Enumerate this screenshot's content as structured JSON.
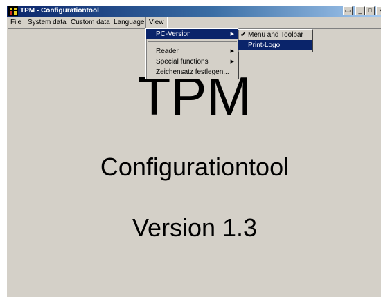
{
  "window": {
    "title": "TPM - Configurationtool",
    "buttons": {
      "restore": "▭",
      "minimize": "_",
      "maximize": "□",
      "close": "×"
    }
  },
  "menubar": {
    "items": [
      "File",
      "System data",
      "Custom data",
      "Language",
      "View"
    ]
  },
  "view_menu": {
    "items": [
      {
        "label": "PC-Version",
        "submenu": true,
        "highlighted": true
      },
      {
        "label": "Reader",
        "submenu": true
      },
      {
        "label": "Special functions",
        "submenu": true
      },
      {
        "label": "Zeichensatz festlegen..."
      }
    ]
  },
  "pc_version_submenu": {
    "items": [
      {
        "label": "Menu and Toolbar",
        "checked": true,
        "check_mark": "✔"
      },
      {
        "label": "Print-Logo",
        "highlighted": true
      }
    ]
  },
  "main": {
    "heading": "TPM",
    "subheading": "Configurationtool",
    "version": "Version 1.3"
  },
  "colors": {
    "face": "#d4d0c8",
    "title_active": "#0a246a",
    "highlight": "#0a246a",
    "highlight_text": "#ffffff"
  },
  "icons": {
    "app": "tpm-app-icon",
    "submenu_arrow": "▶"
  }
}
